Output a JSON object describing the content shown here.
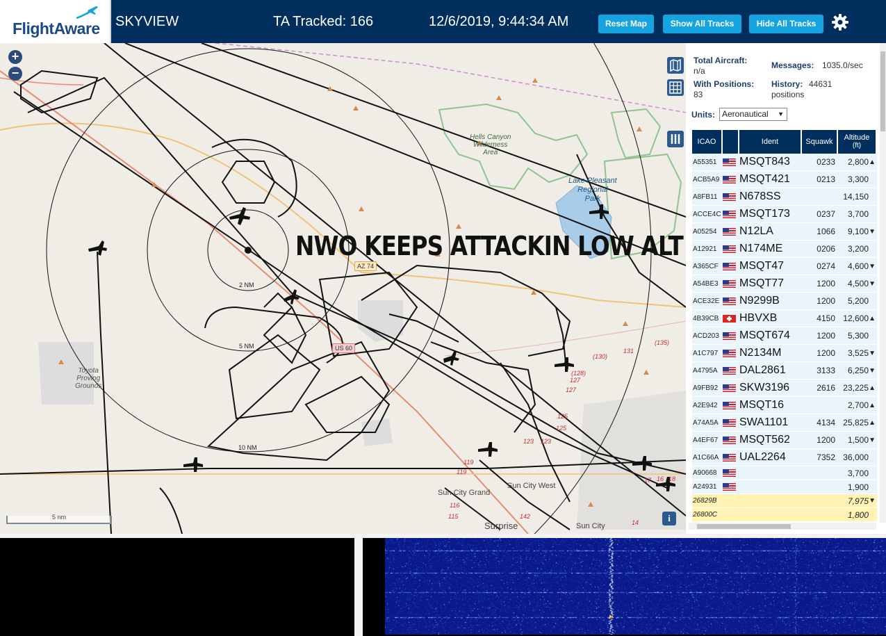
{
  "header": {
    "logo_text": "FlightAware",
    "site_name": "SKYVIEW",
    "tracked_text": "TA Tracked: 166",
    "datetime": "12/6/2019, 9:44:34 AM",
    "buttons": {
      "reset_map": "Reset Map",
      "show_all_tracks": "Show All Tracks",
      "hide_all_tracks": "Hide All Tracks"
    },
    "icons": {
      "settings": "gear-icon",
      "logo_plane": "airplane-icon"
    }
  },
  "map": {
    "overlay_caption": "NWO KEEPS ATTACKIN LOW ALT",
    "scale_label": "5 nm",
    "range_rings": [
      "2 NM",
      "5 NM",
      "10 NM"
    ],
    "road_signs": [
      "AZ 74",
      "US 60"
    ],
    "places": {
      "hells_canyon": [
        "Hells Canyon",
        "Wilderness",
        "Area"
      ],
      "lake_pleasant": [
        "Lake Pleasant",
        "Regional",
        "Park"
      ],
      "toyota": [
        "Toyota",
        "Proving",
        "Grounds"
      ],
      "sun_city_grand": "Sun City Grand",
      "sun_city_west": "Sun City West",
      "surprise": "Surprise",
      "sun_city": "Sun City"
    },
    "exits": [
      "(135)",
      "131",
      "(130)",
      "(128)",
      "127",
      "127",
      "125",
      "125",
      "123",
      "123",
      "119",
      "119",
      "116",
      "115",
      "142",
      "14",
      "17",
      "16",
      "18"
    ],
    "controls": {
      "zoom_in": "+",
      "zoom_out": "−",
      "info": "i",
      "icons": [
        "map-layers-icon",
        "grid-icon",
        "columns-icon"
      ]
    }
  },
  "stats": {
    "total_aircraft_label": "Total Aircraft:",
    "total_aircraft_value": "n/a",
    "messages_label": "Messages:",
    "messages_value": "1035.0/sec",
    "with_positions_label": "With Positions:",
    "with_positions_value": "83",
    "history_label": "History:",
    "history_value": "44631",
    "history_unit": "positions",
    "units_label": "Units:",
    "units_value": "Aeronautical"
  },
  "table": {
    "headers": {
      "icao": "ICAO",
      "flag": "",
      "ident": "Ident",
      "squawk": "Squawk",
      "altitude": "Altitude",
      "altitude_unit": "(ft)"
    },
    "rows": [
      {
        "icao": "A55351",
        "flag": "us",
        "ident": "MSQT843",
        "squawk": "0233",
        "alt": "2,800",
        "trend": "▲",
        "small": false,
        "mlat": false
      },
      {
        "icao": "ACB5A9",
        "flag": "us",
        "ident": "MSQT421",
        "squawk": "0213",
        "alt": "3,300",
        "trend": "",
        "small": false,
        "mlat": false
      },
      {
        "icao": "A8FB11",
        "flag": "us",
        "ident": "N678SS",
        "squawk": "",
        "alt": "14,150",
        "trend": "",
        "small": false,
        "mlat": false
      },
      {
        "icao": "ACCE4C",
        "flag": "us",
        "ident": "MSQT173",
        "squawk": "0237",
        "alt": "3,700",
        "trend": "",
        "small": false,
        "mlat": false
      },
      {
        "icao": "A05254",
        "flag": "us",
        "ident": "N12LA",
        "squawk": "1066",
        "alt": "9,100",
        "trend": "▼",
        "small": false,
        "mlat": false
      },
      {
        "icao": "A12921",
        "flag": "us",
        "ident": "N174ME",
        "squawk": "0206",
        "alt": "3,200",
        "trend": "",
        "small": false,
        "mlat": false
      },
      {
        "icao": "A365CF",
        "flag": "us",
        "ident": "MSQT47",
        "squawk": "0274",
        "alt": "4,600",
        "trend": "▼",
        "small": false,
        "mlat": false
      },
      {
        "icao": "A54BE3",
        "flag": "us",
        "ident": "MSQT77",
        "squawk": "1200",
        "alt": "4,500",
        "trend": "▼",
        "small": false,
        "mlat": false
      },
      {
        "icao": "ACE32E",
        "flag": "us",
        "ident": "N9299B",
        "squawk": "1200",
        "alt": "5,200",
        "trend": "",
        "small": false,
        "mlat": false
      },
      {
        "icao": "4B39CB",
        "flag": "ch",
        "ident": "HBVXB",
        "squawk": "4150",
        "alt": "12,600",
        "trend": "▲",
        "small": false,
        "mlat": false
      },
      {
        "icao": "ACD203",
        "flag": "us",
        "ident": "MSQT674",
        "squawk": "1200",
        "alt": "5,300",
        "trend": "",
        "small": false,
        "mlat": false
      },
      {
        "icao": "A1C797",
        "flag": "us",
        "ident": "N2134M",
        "squawk": "1200",
        "alt": "3,525",
        "trend": "▼",
        "small": false,
        "mlat": false
      },
      {
        "icao": "A4795A",
        "flag": "us",
        "ident": "DAL2861",
        "squawk": "3133",
        "alt": "6,250",
        "trend": "▼",
        "small": false,
        "mlat": false
      },
      {
        "icao": "A9FB92",
        "flag": "us",
        "ident": "SKW3196",
        "squawk": "2616",
        "alt": "23,225",
        "trend": "▲",
        "small": false,
        "mlat": false
      },
      {
        "icao": "A2E942",
        "flag": "us",
        "ident": "MSQT16",
        "squawk": "",
        "alt": "2,700",
        "trend": "▲",
        "small": false,
        "mlat": false
      },
      {
        "icao": "A74A5A",
        "flag": "us",
        "ident": "SWA1101",
        "squawk": "4134",
        "alt": "25,825",
        "trend": "▲",
        "small": false,
        "mlat": false
      },
      {
        "icao": "A4EF67",
        "flag": "us",
        "ident": "MSQT562",
        "squawk": "1200",
        "alt": "1,500",
        "trend": "▼",
        "small": false,
        "mlat": false
      },
      {
        "icao": "A1C66A",
        "flag": "us",
        "ident": "UAL2264",
        "squawk": "7352",
        "alt": "36,000",
        "trend": "",
        "small": false,
        "mlat": false
      },
      {
        "icao": "A90668",
        "flag": "us",
        "ident": "",
        "squawk": "",
        "alt": "3,700",
        "trend": "",
        "small": true,
        "mlat": false
      },
      {
        "icao": "A24931",
        "flag": "us",
        "ident": "",
        "squawk": "",
        "alt": "1,900",
        "trend": "",
        "small": true,
        "mlat": false
      },
      {
        "icao": "26829B",
        "flag": "",
        "ident": "",
        "squawk": "",
        "alt": "7,975",
        "trend": "▼",
        "small": true,
        "mlat": true
      },
      {
        "icao": "26800C",
        "flag": "",
        "ident": "",
        "squawk": "",
        "alt": "1,800",
        "trend": "",
        "small": true,
        "mlat": true
      }
    ]
  },
  "colors": {
    "header_bg": "#002f5d",
    "button_bg": "#15a4e0",
    "table_header_bg": "#002f5d",
    "row_bg": "#eaf5fb",
    "mlat_row_bg": "#fff2b3",
    "map_bg": "#f0ede6",
    "track_color": "#111111",
    "waterfall_bg": "#0a1a8a"
  }
}
